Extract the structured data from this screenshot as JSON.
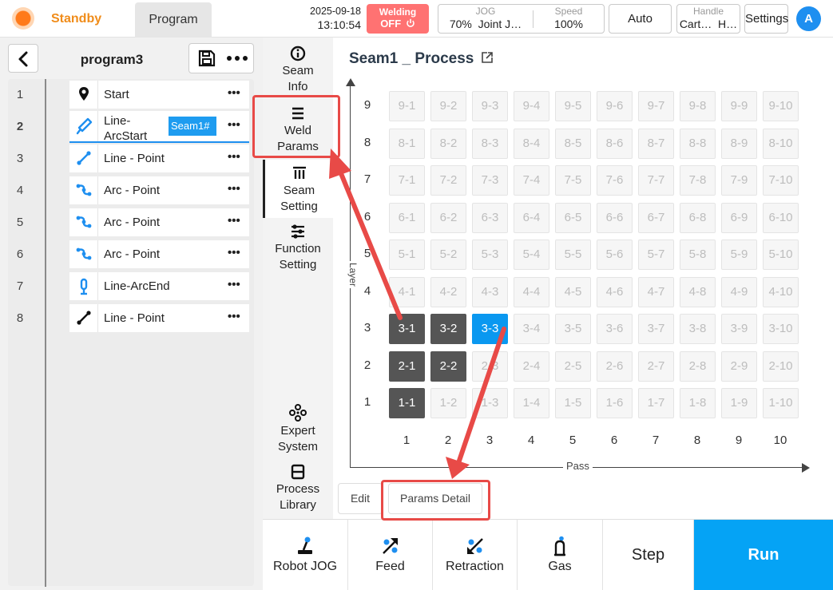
{
  "topbar": {
    "status": "Standby",
    "program_tab": "Program",
    "date": "2025-09-18",
    "time": "13:10:54",
    "welding_label": "Welding",
    "welding_state": "OFF",
    "jog_label": "JOG",
    "jog_value_percent": "70%",
    "jog_mode": "Joint J…",
    "speed_label": "Speed",
    "speed_value": "100%",
    "mode": "Auto",
    "handle_label": "Handle",
    "handle_value_1": "Cart…",
    "handle_value_2": "H…",
    "settings": "Settings",
    "user_initial": "A"
  },
  "program": {
    "name": "program3",
    "lines": [
      {
        "no": "1",
        "label": "Start",
        "icon": "location-pin-icon"
      },
      {
        "no": "2",
        "label_1": "Line-",
        "label_2": "ArcStart",
        "icon": "torch-icon",
        "tag": "Seam1#"
      },
      {
        "no": "3",
        "label": "Line - Point",
        "icon": "line-point-icon"
      },
      {
        "no": "4",
        "label": "Arc - Point",
        "icon": "arc-point-icon"
      },
      {
        "no": "5",
        "label": "Arc - Point",
        "icon": "arc-point-icon"
      },
      {
        "no": "6",
        "label": "Arc - Point",
        "icon": "arc-point-icon"
      },
      {
        "no": "7",
        "label": "Line-ArcEnd",
        "icon": "arc-end-icon"
      },
      {
        "no": "8",
        "label": "Line - Point",
        "icon": "line-point-icon"
      }
    ]
  },
  "nav": {
    "seam_info_1": "Seam",
    "seam_info_2": "Info",
    "weld_params_1": "Weld",
    "weld_params_2": "Params",
    "seam_setting_1": "Seam",
    "seam_setting_2": "Setting",
    "function_setting_1": "Function",
    "function_setting_2": "Setting",
    "expert_system_1": "Expert",
    "expert_system_2": "System",
    "process_library_1": "Process",
    "process_library_2": "Library"
  },
  "main": {
    "title": "Seam1 _ Process",
    "y_axis_label": "Layer",
    "x_axis_label": "Pass",
    "layers": [
      "1",
      "2",
      "3",
      "4",
      "5",
      "6",
      "7",
      "8",
      "9"
    ],
    "passes": [
      "1",
      "2",
      "3",
      "4",
      "5",
      "6",
      "7",
      "8",
      "9",
      "10"
    ],
    "done_cells": [
      "1-1",
      "2-1",
      "2-2",
      "3-1",
      "3-2"
    ],
    "active_cell": "3-3",
    "edit_button": "Edit",
    "params_detail_button": "Params Detail"
  },
  "toolbar": {
    "robot_jog": "Robot JOG",
    "feed": "Feed",
    "retraction": "Retraction",
    "gas": "Gas",
    "step": "Step",
    "run": "Run"
  },
  "colors": {
    "accent": "#05a3f5",
    "status_orange": "#f08c1a",
    "welding_off": "#ff7272",
    "done_cell": "#555555",
    "annotation_red": "#e84a47"
  }
}
